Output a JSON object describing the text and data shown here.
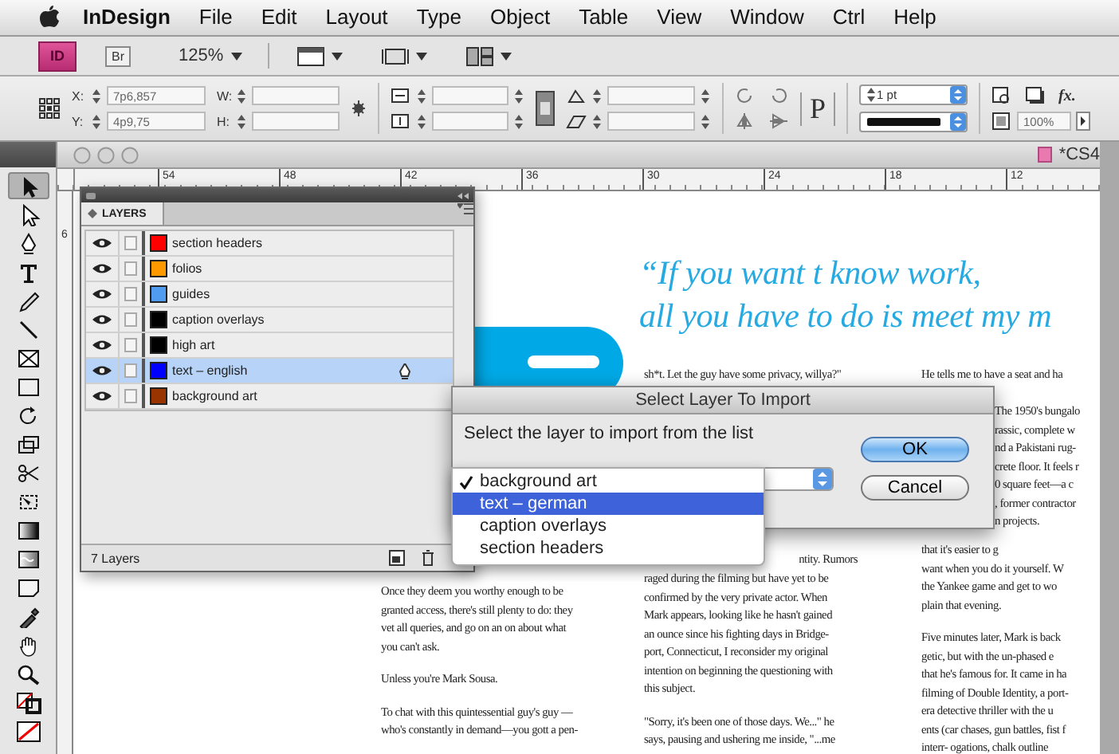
{
  "menu_bar": {
    "app_name": "InDesign",
    "items": [
      "File",
      "Edit",
      "Layout",
      "Type",
      "Object",
      "Table",
      "View",
      "Window",
      "Ctrl",
      "Help"
    ]
  },
  "app_bar": {
    "logo": "ID",
    "bridge_button": "Br",
    "zoom": "125%"
  },
  "control_panel": {
    "x_label": "X:",
    "x_value": "7p6,857",
    "y_label": "Y:",
    "y_value": "4p9,75",
    "w_label": "W:",
    "h_label": "H:",
    "paragraph_glyph": "P",
    "stroke_weight": "1 pt",
    "effects_label": "fx.",
    "opacity": "100%"
  },
  "tools_panel": {
    "tools": [
      {
        "kind": "selection",
        "selected": true
      },
      {
        "kind": "direct-selection",
        "selected": false
      },
      {
        "kind": "pen",
        "selected": false
      },
      {
        "kind": "type",
        "selected": false
      },
      {
        "kind": "pencil",
        "selected": false
      },
      {
        "kind": "line",
        "selected": false
      },
      {
        "kind": "frame",
        "selected": false
      },
      {
        "kind": "rectangle",
        "selected": false
      },
      {
        "kind": "rotate",
        "selected": false
      },
      {
        "kind": "scale",
        "selected": false
      },
      {
        "kind": "scissors",
        "selected": false
      },
      {
        "kind": "free-transform",
        "selected": false
      },
      {
        "kind": "gradient",
        "selected": false
      },
      {
        "kind": "gradient-feather",
        "selected": false
      },
      {
        "kind": "note",
        "selected": false
      },
      {
        "kind": "eyedropper",
        "selected": false
      },
      {
        "kind": "hand",
        "selected": false
      },
      {
        "kind": "zoom",
        "selected": false
      },
      {
        "kind": "fill-stroke",
        "selected": false
      },
      {
        "kind": "apply-none",
        "selected": false
      }
    ]
  },
  "document": {
    "title": "*CS4",
    "horizontal_ruler": [
      "54",
      "48",
      "42",
      "36",
      "30",
      "24",
      "18",
      "12"
    ],
    "vertical_ruler": [
      "6"
    ],
    "pull_quote": [
      "“If you want t know work,",
      "all you have to do is meet my m"
    ],
    "text_frames": [
      {
        "paragraphs": [
          [
            "sh*t. Let the guy have some privacy, willya?\""
          ]
        ]
      },
      {
        "paragraphs": [
          [
            "He tells me to have a seat and ha"
          ]
        ]
      },
      {
        "paragraphs": [
          [
            "The 1950's bungalo",
            "rassic, complete w",
            "nd a Pakistani rug-",
            "crete floor. It feels r",
            "0 square feet—a c",
            ", former contractor",
            "n projects."
          ]
        ]
      },
      {
        "paragraphs": [
          [
            "that it's easier to g",
            "want when you do it yourself. W",
            "the Yankee game and get to wo",
            "plain that evening."
          ],
          [
            "Five minutes later, Mark is back",
            "getic, but with the un-phased e",
            "that he's famous for. It came in ha",
            "filming of Double Identity, a port-",
            "era detective thriller with the u",
            "ents (car chases, gun battles, fist f",
            "interr- ogations, chalk outline"
          ]
        ]
      },
      {
        "paragraphs": [
          [
            "Once they deem you worthy enough to be",
            "granted access, there's still plenty to do: they",
            "vet all queries, and go on an on about what",
            "you can't ask."
          ],
          [
            "Unless you're Mark Sousa."
          ],
          [
            "To chat with this quintessential guy's guy —",
            "who's constantly in demand—you gott a pen-"
          ]
        ]
      },
      {
        "paragraphs": [
          [
            "ntity. Rumors"
          ]
        ]
      },
      {
        "paragraphs": [
          [
            "raged during the filming but have yet to be",
            "confirmed by the very private actor. When",
            "Mark appears, looking like he hasn't gained",
            "an ounce since his fighting days in Bridge-",
            "port, Connecticut, I reconsider my original",
            "intention on beginning the questioning with",
            "this subject."
          ],
          [
            "\"Sorry, it's been one of those days. We...\" he",
            "says, pausing and ushering me inside, \"...me"
          ]
        ]
      }
    ]
  },
  "layers_panel": {
    "tab": "LAYERS",
    "layers": [
      {
        "name": "section headers",
        "color": "#ff0000",
        "visible": true,
        "locked": false,
        "selected": false
      },
      {
        "name": "folios",
        "color": "#ff9900",
        "visible": true,
        "locked": false,
        "selected": false
      },
      {
        "name": "guides",
        "color": "#4f9cf0",
        "visible": true,
        "locked": false,
        "selected": false
      },
      {
        "name": "caption overlays",
        "color": "#000000",
        "visible": true,
        "locked": false,
        "selected": false
      },
      {
        "name": "high art",
        "color": "#000000",
        "visible": true,
        "locked": false,
        "selected": false
      },
      {
        "name": "text – english",
        "color": "#0000ff",
        "visible": true,
        "locked": false,
        "selected": true
      },
      {
        "name": "background art",
        "color": "#993300",
        "visible": true,
        "locked": false,
        "selected": false
      }
    ],
    "footer": "7 Layers"
  },
  "import_dialog": {
    "title": "Select Layer To Import",
    "message": "Select the layer to import from the list",
    "options": [
      {
        "label": "background art",
        "selected": true,
        "highlighted": false
      },
      {
        "label": "text – german",
        "selected": false,
        "highlighted": true
      },
      {
        "label": "caption overlays",
        "selected": false,
        "highlighted": false
      },
      {
        "label": "section headers",
        "selected": false,
        "highlighted": false
      }
    ],
    "buttons": [
      {
        "label": "OK",
        "default": true
      },
      {
        "label": "Cancel",
        "default": false
      }
    ]
  }
}
